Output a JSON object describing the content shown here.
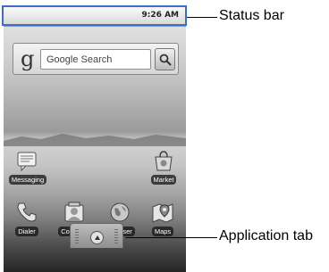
{
  "status_bar": {
    "time": "9:26 AM"
  },
  "search_widget": {
    "logo": "g",
    "placeholder": "Google Search"
  },
  "shortcuts": [
    {
      "label": "Messaging",
      "icon": "messaging-icon"
    },
    {
      "label": "Market",
      "icon": "market-icon"
    }
  ],
  "dock": [
    {
      "label": "Dialer",
      "icon": "dialer-icon"
    },
    {
      "label": "Contacts",
      "icon": "contacts-icon"
    },
    {
      "label": "Browser",
      "icon": "browser-icon"
    },
    {
      "label": "Maps",
      "icon": "maps-icon"
    }
  ],
  "callouts": {
    "status_bar": "Status bar",
    "application_tab": "Application tab"
  }
}
